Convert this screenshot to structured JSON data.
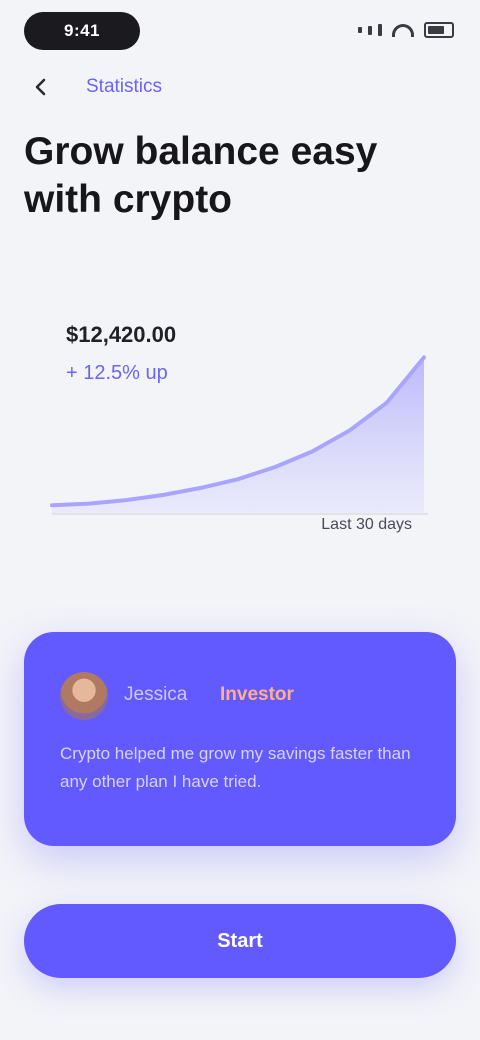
{
  "status_bar": {
    "time": "9:41"
  },
  "nav": {
    "link_label": "Statistics"
  },
  "page": {
    "title": "Grow balance easy with crypto"
  },
  "chart": {
    "value": "$12,420.00",
    "change": "+ 12.5% up",
    "range": "Last 30 days",
    "accent_color": "#6b63ff"
  },
  "message": {
    "name": "Jessica",
    "tag": "Investor",
    "body": "Crypto helped me grow my savings faster than any other plan I have tried."
  },
  "button": {
    "label": "Start"
  },
  "chart_data": {
    "type": "area",
    "x": [
      0,
      1,
      2,
      3,
      4,
      5,
      6,
      7,
      8,
      9,
      10
    ],
    "values": [
      5,
      6,
      8,
      11,
      15,
      20,
      27,
      36,
      48,
      64,
      90
    ],
    "ylim": [
      0,
      100
    ],
    "grid": false,
    "title": "",
    "xlabel": "",
    "ylabel": ""
  }
}
